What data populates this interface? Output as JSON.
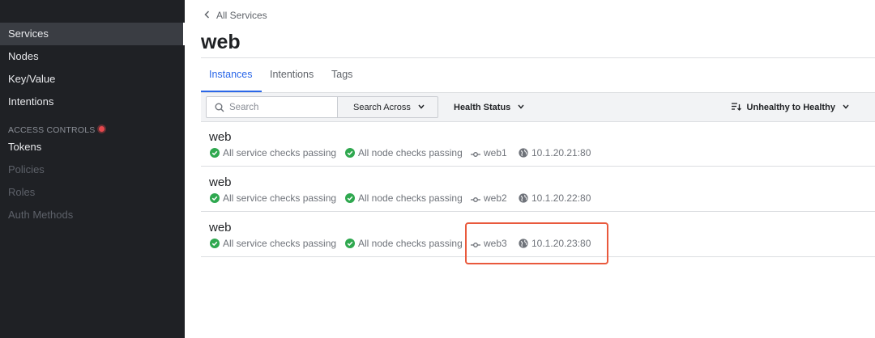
{
  "sidebar": {
    "items": [
      {
        "label": "Services"
      },
      {
        "label": "Nodes"
      },
      {
        "label": "Key/Value"
      },
      {
        "label": "Intentions"
      }
    ],
    "access_controls": {
      "heading": "ACCESS CONTROLS",
      "items": [
        {
          "label": "Tokens"
        },
        {
          "label": "Policies"
        },
        {
          "label": "Roles"
        },
        {
          "label": "Auth Methods"
        }
      ]
    }
  },
  "breadcrumb": {
    "label": "All Services"
  },
  "page": {
    "title": "web"
  },
  "tabs": [
    {
      "label": "Instances"
    },
    {
      "label": "Intentions"
    },
    {
      "label": "Tags"
    }
  ],
  "toolbar": {
    "search_placeholder": "Search",
    "search_across_label": "Search Across",
    "health_status_label": "Health Status",
    "sort_label": "Unhealthy to Healthy"
  },
  "instances": [
    {
      "name": "web",
      "service_checks": "All service checks passing",
      "node_checks": "All node checks passing",
      "node": "web1",
      "address": "10.1.20.21:80"
    },
    {
      "name": "web",
      "service_checks": "All service checks passing",
      "node_checks": "All node checks passing",
      "node": "web2",
      "address": "10.1.20.22:80"
    },
    {
      "name": "web",
      "service_checks": "All service checks passing",
      "node_checks": "All node checks passing",
      "node": "web3",
      "address": "10.1.20.23:80"
    }
  ],
  "colors": {
    "sidebar_bg": "#1f2125",
    "accent": "#2a67e8",
    "passing": "#2fa84f",
    "highlight": "#e9593c"
  }
}
